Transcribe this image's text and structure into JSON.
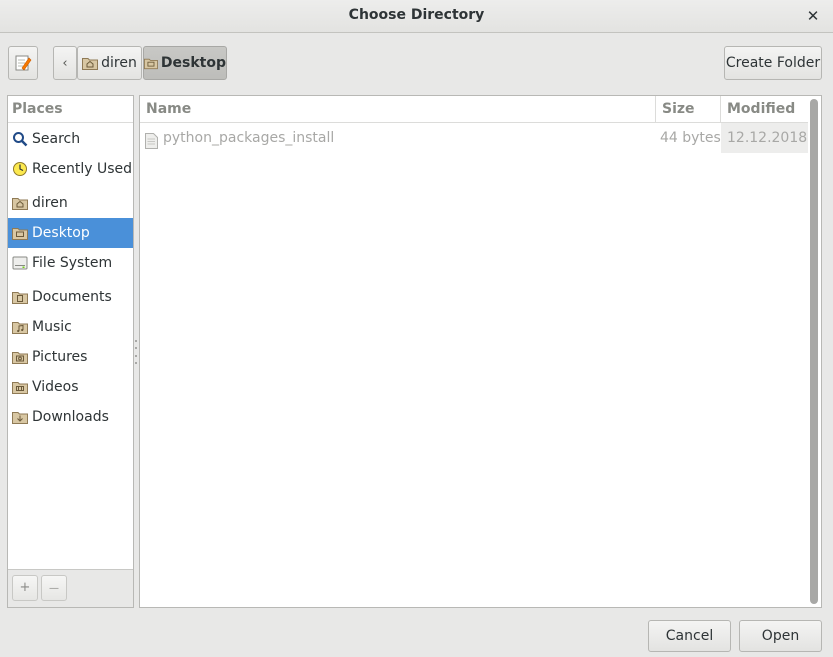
{
  "window": {
    "title": "Choose Directory",
    "close_icon": "close-icon"
  },
  "toolbar": {
    "edit_location_icon": "pencil-note-icon",
    "back_icon": "chevron-left-icon",
    "path": [
      {
        "label": "diren",
        "icon": "home-folder-icon",
        "active": false
      },
      {
        "label": "Desktop",
        "icon": "desktop-folder-icon",
        "active": true
      }
    ],
    "create_folder_label": "Create Folder"
  },
  "places": {
    "header": "Places",
    "items": [
      {
        "label": "Search",
        "icon": "search-icon"
      },
      {
        "label": "Recently Used",
        "icon": "clock-icon"
      },
      {
        "label": "diren",
        "icon": "home-folder-icon"
      },
      {
        "label": "Desktop",
        "icon": "desktop-folder-icon",
        "selected": true
      },
      {
        "label": "File System",
        "icon": "drive-icon"
      },
      {
        "label": "Documents",
        "icon": "documents-folder-icon"
      },
      {
        "label": "Music",
        "icon": "music-folder-icon"
      },
      {
        "label": "Pictures",
        "icon": "pictures-folder-icon"
      },
      {
        "label": "Videos",
        "icon": "videos-folder-icon"
      },
      {
        "label": "Downloads",
        "icon": "downloads-folder-icon"
      }
    ],
    "add_label": "+",
    "remove_label": "—"
  },
  "files": {
    "columns": {
      "name": "Name",
      "size": "Size",
      "modified": "Modified"
    },
    "sort_indicator": "^",
    "rows": [
      {
        "name": "python_packages_install",
        "size": "44 bytes",
        "modified": "12.12.2018",
        "icon": "text-file-icon"
      }
    ]
  },
  "actions": {
    "cancel_label": "Cancel",
    "open_label": "Open"
  },
  "colors": {
    "selection": "#4a90d9",
    "background": "#e8e8e7",
    "dim_text": "#a8a8a6"
  }
}
